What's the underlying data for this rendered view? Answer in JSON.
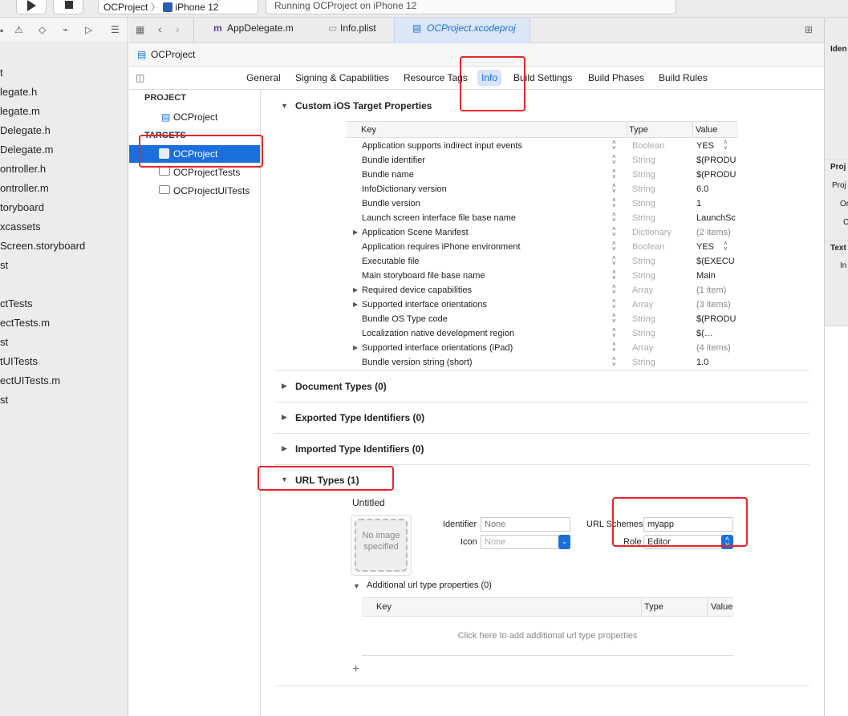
{
  "toolbar": {
    "scheme_project": "OCProject",
    "scheme_device": "iPhone 12",
    "activity": "Running OCProject on iPhone 12"
  },
  "sidebar": {
    "items": [
      "t",
      "legate.h",
      "legate.m",
      "Delegate.h",
      "Delegate.m",
      "ontroller.h",
      "ontroller.m",
      "toryboard",
      "xcassets",
      "Screen.storyboard",
      "st",
      "",
      "ctTests",
      "ectTests.m",
      "st",
      "tUITests",
      "ectUITests.m",
      "st"
    ]
  },
  "tabs": [
    {
      "label": "AppDelegate.m",
      "icon": "m"
    },
    {
      "label": "Info.plist"
    },
    {
      "label": "OCProject.xcodeproj"
    }
  ],
  "breadcrumb": "OCProject",
  "segments": [
    "General",
    "Signing & Capabilities",
    "Resource Tags",
    "Info",
    "Build Settings",
    "Build Phases",
    "Build Rules"
  ],
  "targets_panel": {
    "project_header": "PROJECT",
    "project": "OCProject",
    "targets_header": "TARGETS",
    "targets": [
      "OCProject",
      "OCProjectTests",
      "OCProjectUITests"
    ]
  },
  "custom_props": {
    "title": "Custom iOS Target Properties",
    "columns": [
      "Key",
      "Type",
      "Value"
    ],
    "rows": [
      {
        "key": "Application supports indirect input events",
        "type": "Boolean",
        "value": "YES",
        "expand": false
      },
      {
        "key": "Bundle identifier",
        "type": "String",
        "value": "$(PRODU",
        "expand": false
      },
      {
        "key": "Bundle name",
        "type": "String",
        "value": "$(PRODU",
        "expand": false
      },
      {
        "key": "InfoDictionary version",
        "type": "String",
        "value": "6.0",
        "expand": false
      },
      {
        "key": "Bundle version",
        "type": "String",
        "value": "1",
        "expand": false
      },
      {
        "key": "Launch screen interface file base name",
        "type": "String",
        "value": "LaunchSc",
        "expand": false
      },
      {
        "key": "Application Scene Manifest",
        "type": "Dictionary",
        "value": "(2 items)",
        "expand": true
      },
      {
        "key": "Application requires iPhone environment",
        "type": "Boolean",
        "value": "YES",
        "expand": false
      },
      {
        "key": "Executable file",
        "type": "String",
        "value": "$(EXECU",
        "expand": false
      },
      {
        "key": "Main storyboard file base name",
        "type": "String",
        "value": "Main",
        "expand": false
      },
      {
        "key": "Required device capabilities",
        "type": "Array",
        "value": "(1 item)",
        "expand": true
      },
      {
        "key": "Supported interface orientations",
        "type": "Array",
        "value": "(3 items)",
        "expand": true
      },
      {
        "key": "Bundle OS Type code",
        "type": "String",
        "value": "$(PRODU",
        "expand": false
      },
      {
        "key": "Localization native development region",
        "type": "String",
        "value": "$(…",
        "expand": false
      },
      {
        "key": "Supported interface orientations (iPad)",
        "type": "Array",
        "value": "(4 items)",
        "expand": true
      },
      {
        "key": "Bundle version string (short)",
        "type": "String",
        "value": "1.0",
        "expand": false
      }
    ]
  },
  "sections": {
    "document_types": "Document Types (0)",
    "exported": "Exported Type Identifiers (0)",
    "imported": "Imported Type Identifiers (0)",
    "url_types": "URL Types (1)"
  },
  "url_type": {
    "name": "Untitled",
    "image_placeholder": "No image specified",
    "identifier_label": "Identifier",
    "identifier_placeholder": "None",
    "icon_label": "Icon",
    "icon_placeholder": "None",
    "url_schemes_label": "URL Schemes",
    "url_schemes_value": "myapp",
    "role_label": "Role",
    "role_value": "Editor",
    "additional_title": "Additional url type properties (0)",
    "add_columns": [
      "Key",
      "Type",
      "Value"
    ],
    "add_hint": "Click here to add additional url type properties",
    "plus": "+"
  },
  "inspector": {
    "items": [
      "Iden",
      "Proj",
      "Proj",
      "Or",
      "C",
      "Text",
      "In"
    ]
  },
  "colors": {
    "accent": "#1a6fdd",
    "highlight_red": "#e8252a"
  }
}
